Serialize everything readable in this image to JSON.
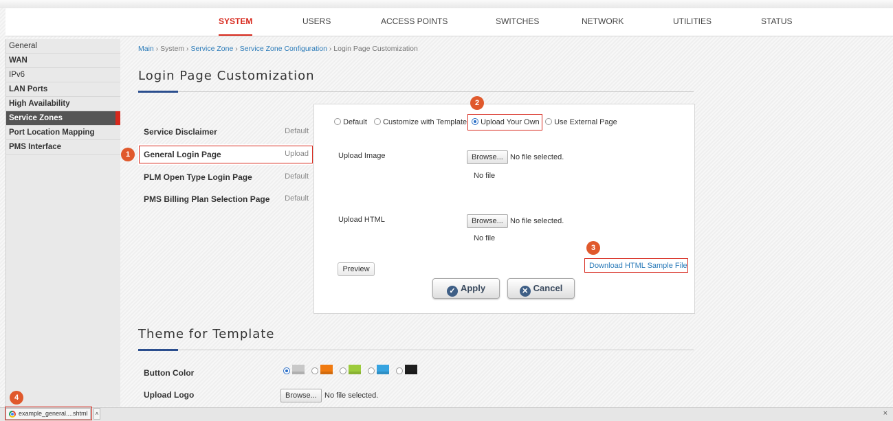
{
  "nav": {
    "items": [
      {
        "label": "SYSTEM",
        "active": true
      },
      {
        "label": "USERS"
      },
      {
        "label": "ACCESS POINTS"
      },
      {
        "label": "SWITCHES"
      },
      {
        "label": "NETWORK"
      },
      {
        "label": "UTILITIES"
      },
      {
        "label": "STATUS"
      }
    ]
  },
  "sidebar": {
    "items": [
      {
        "label": "General"
      },
      {
        "label": "WAN"
      },
      {
        "label": "IPv6"
      },
      {
        "label": "LAN Ports"
      },
      {
        "label": "High Availability"
      },
      {
        "label": "Service Zones",
        "active": true
      },
      {
        "label": "Port Location Mapping"
      },
      {
        "label": "PMS Interface"
      }
    ]
  },
  "breadcrumb": {
    "main": "Main",
    "system": "System",
    "service_zone": "Service Zone",
    "service_zone_config": "Service Zone Configuration",
    "current": "Login Page Customization",
    "sep": "›"
  },
  "page_title": "Login Page Customization",
  "login_pages": [
    {
      "name": "Service Disclaimer",
      "mode": "Default"
    },
    {
      "name": "General Login Page",
      "mode": "Upload"
    },
    {
      "name": "PLM Open Type Login Page",
      "mode": "Default"
    },
    {
      "name": "PMS Billing Plan Selection Page",
      "mode": "Default"
    }
  ],
  "panel": {
    "options": [
      {
        "label": "Default",
        "selected": false
      },
      {
        "label": "Customize with Template",
        "selected": false
      },
      {
        "label": "Upload Your Own",
        "selected": true
      },
      {
        "label": "Use External Page",
        "selected": false
      }
    ],
    "upload_image_label": "Upload Image",
    "upload_html_label": "Upload HTML",
    "browse_label": "Browse...",
    "no_file_selected": "No file selected.",
    "no_file": "No file",
    "preview_label": "Preview",
    "download_link": "Download HTML Sample File",
    "apply_label": "Apply",
    "cancel_label": "Cancel"
  },
  "theme": {
    "title": "Theme for Template",
    "button_color_label": "Button Color",
    "upload_logo_label": "Upload Logo",
    "colors": [
      "#c8c8c8",
      "#f07a10",
      "#9ccb3b",
      "#36a3e0",
      "#1e1e1e"
    ],
    "selected_color_index": 0
  },
  "annotations": [
    "1",
    "2",
    "3",
    "4"
  ],
  "download_bar": {
    "file_name": "example_general....shtml",
    "close_label": "×",
    "menu_label": "˄"
  },
  "colors": {
    "accent": "#d7281c",
    "link": "#2b7bb9",
    "title_accent": "#2b4e8e"
  }
}
